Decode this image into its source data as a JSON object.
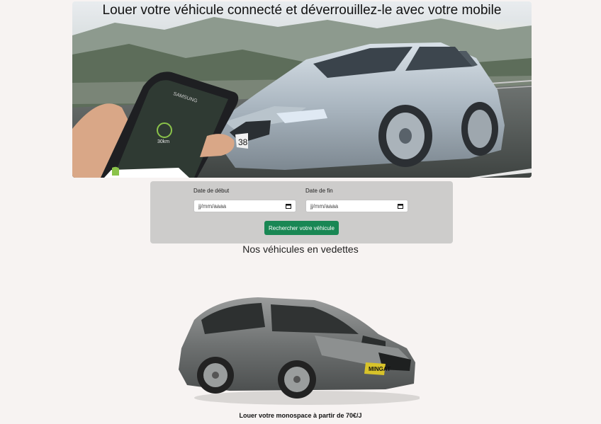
{
  "hero": {
    "title": "Louer votre véhicule connecté et déverrouillez-le avec votre mobile",
    "plate_text": "38",
    "phone_brand": "SAMSUNG",
    "phone_distance": "30km"
  },
  "search": {
    "start_label": "Date de début",
    "start_placeholder": "jj/mm/aaaa",
    "end_label": "Date de fin",
    "end_placeholder": "jj/mm/aaaa",
    "button_label": "Rechercher votre véhicule"
  },
  "featured": {
    "heading": "Nos véhicules en vedettes",
    "caption": "Louer votre monospace à partir de 70€/J",
    "badge_text": "MINGAT"
  },
  "colors": {
    "button": "#198754",
    "panel": "#cdcccb",
    "background": "#f7f3f2"
  }
}
